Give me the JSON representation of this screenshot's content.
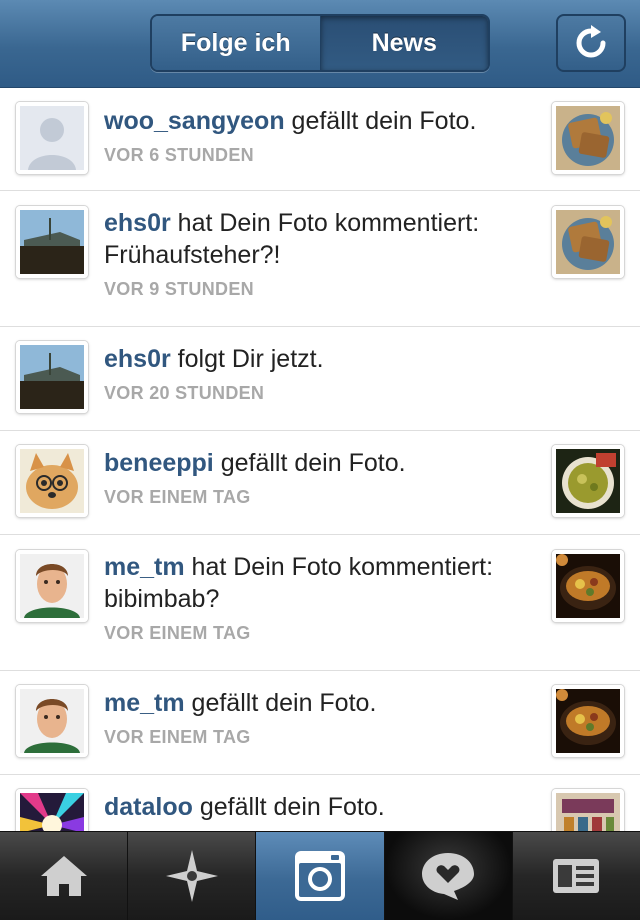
{
  "header": {
    "tabs": [
      "Folge ich",
      "News"
    ],
    "active_tab": "News",
    "refresh_icon": "refresh-icon"
  },
  "feed": {
    "items": [
      {
        "user": "woo_sangyeon",
        "action": "gefällt dein Foto.",
        "time": "VOR 6 STUNDEN",
        "avatar": "default-avatar",
        "thumb": "toast-photo"
      },
      {
        "user": "ehs0r",
        "action": "hat Dein Foto kommentiert: Frühaufsteher?!",
        "time": "VOR 9 STUNDEN",
        "avatar": "building-photo",
        "thumb": "toast-photo"
      },
      {
        "user": "ehs0r",
        "action": "folgt Dir jetzt.",
        "time": "VOR 20 STUNDEN",
        "avatar": "building-photo",
        "thumb": null
      },
      {
        "user": "beneeppi",
        "action": "gefällt dein Foto.",
        "time": "VOR EINEM TAG",
        "avatar": "dog-photo",
        "thumb": "soup-photo"
      },
      {
        "user": "me_tm",
        "action": "hat Dein Foto kommentiert: bibimbab?",
        "time": "VOR EINEM TAG",
        "avatar": "man-photo",
        "thumb": "bibimbap-photo"
      },
      {
        "user": "me_tm",
        "action": "gefällt dein Foto.",
        "time": "VOR EINEM TAG",
        "avatar": "man-photo",
        "thumb": "bibimbap-photo"
      },
      {
        "user": "dataloo",
        "action": "gefällt dein Foto.",
        "time": "",
        "avatar": "starburst-photo",
        "thumb": "shop-photo"
      }
    ]
  },
  "tabbar": {
    "tabs": [
      "home-icon",
      "explore-icon",
      "camera-icon",
      "news-icon",
      "profile-icon"
    ],
    "active": "camera-icon",
    "highlighted": "news-icon"
  },
  "colors": {
    "header_blue": "#3a6791",
    "username_blue": "#31577f",
    "timestamp_gray": "#a8a8a8"
  }
}
